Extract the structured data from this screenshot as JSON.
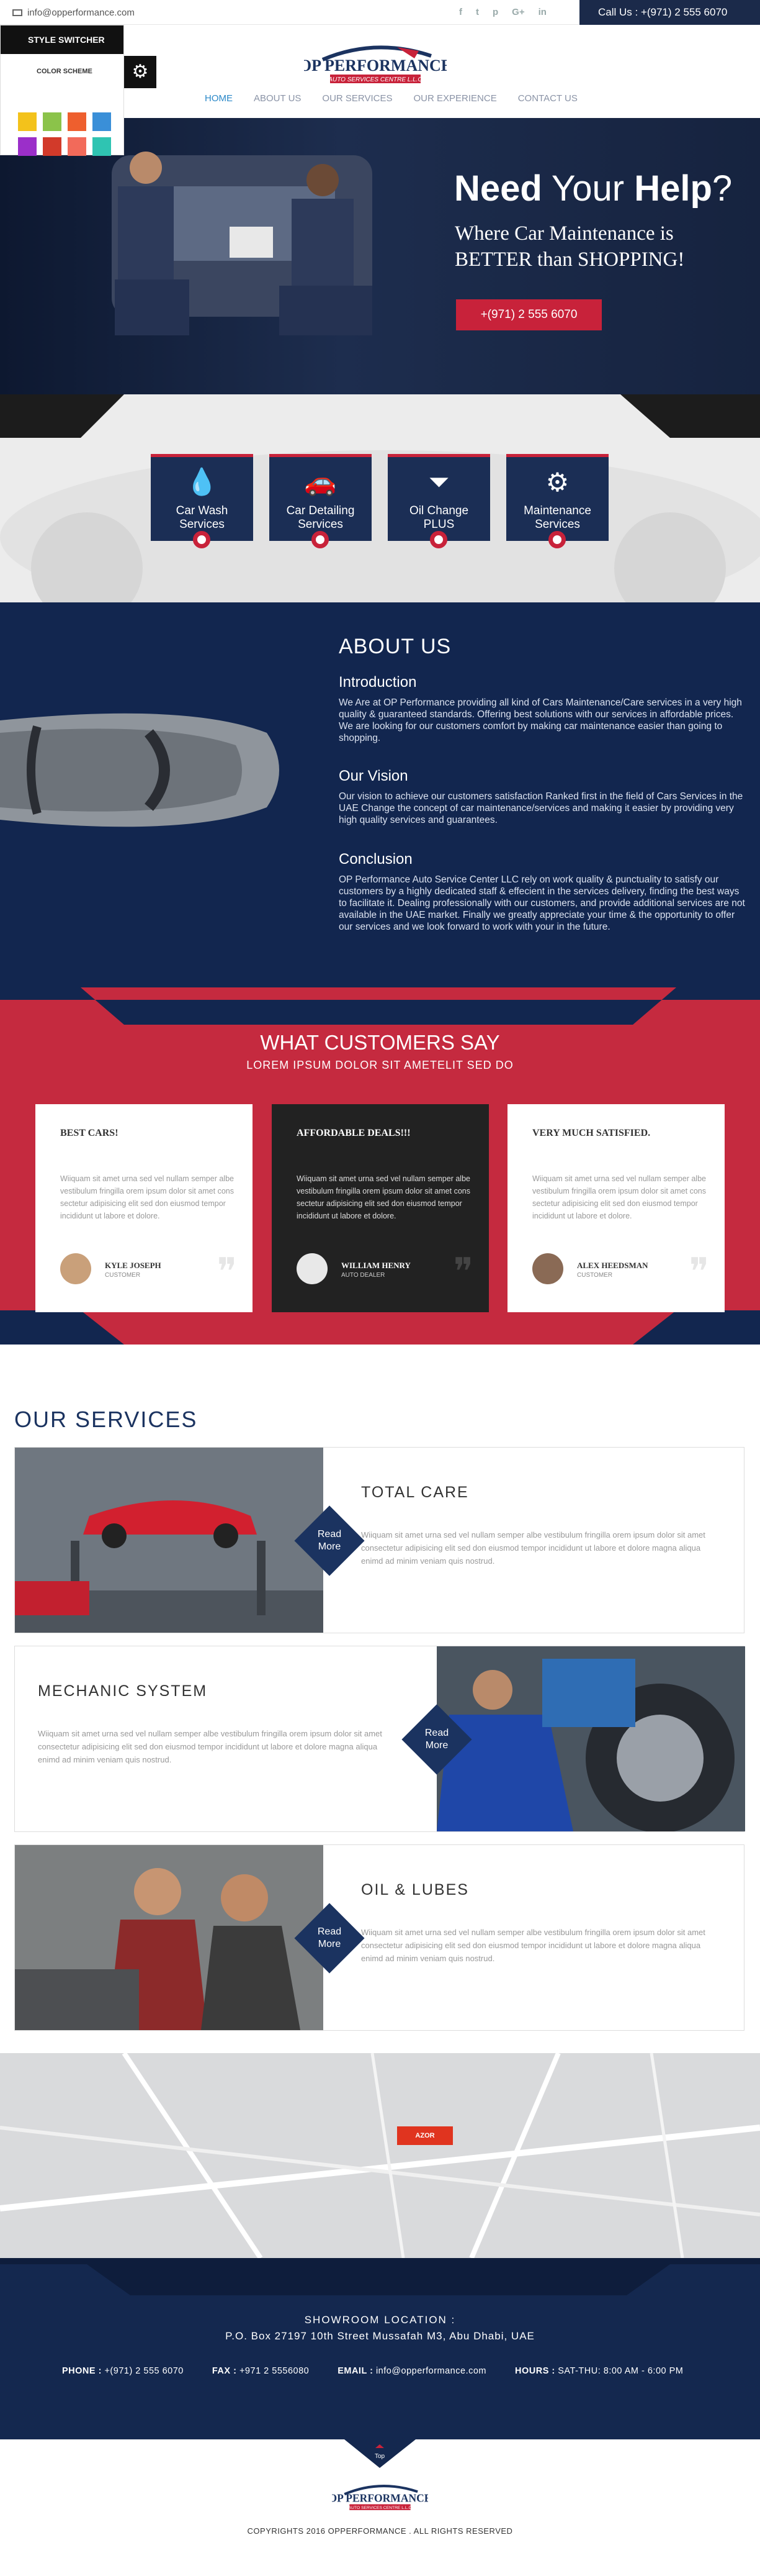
{
  "topbar": {
    "email": "info@opperformance.com",
    "social": [
      "f",
      "t",
      "p",
      "G+",
      "in"
    ],
    "call": "Call Us : +(971) 2 555 6070"
  },
  "logo": {
    "title": "OP PERFORMANCE",
    "subtitle": "AUTO SERVICES CENTRE L.L.C"
  },
  "nav": [
    "HOME",
    "ABOUT US",
    "OUR SERVICES",
    "OUR EXPERIENCE",
    "CONTACT US"
  ],
  "switcher": {
    "title": "STYLE SWITCHER",
    "subtitle": "COLOR SCHEME",
    "colors": [
      "#f3c21b",
      "#8bc34a",
      "#ee5f2e",
      "#3a8fd8",
      "#9b2fc9",
      "#d23a2a",
      "#f26a5a",
      "#2fc4b2"
    ]
  },
  "hero": {
    "title_bold1": "Need",
    "title_mid": " Your ",
    "title_bold2": "Help",
    "title_end": "?",
    "line1": "Where Car Maintenance is",
    "line2": "BETTER than SHOPPING!",
    "cta": "+(971) 2 555 6070"
  },
  "services_icons": [
    {
      "label1": "Car Wash",
      "label2": "Services",
      "icon": "water-drop-icon"
    },
    {
      "label1": "Car Detailing",
      "label2": "Services",
      "icon": "car-icon"
    },
    {
      "label1": "Oil Change",
      "label2": "PLUS",
      "icon": "funnel-icon"
    },
    {
      "label1": "Maintenance",
      "label2": "Services",
      "icon": "engine-icon"
    }
  ],
  "about": {
    "title": "ABOUT US",
    "intro_h": "Introduction",
    "intro": "We Are at OP Performance providing all kind of Cars Maintenance/Care services in a very high quality & guaranteed standards. Offering best solutions with our services in affordable prices. We are looking for our customers comfort by making car maintenance easier than going to shopping.",
    "vision_h": "Our Vision",
    "vision": "Our vision to achieve our customers satisfaction Ranked first in the field of Cars Services in the UAE Change the concept of car maintenance/services and making it easier by providing very high quality services and guarantees.",
    "conc_h": "Conclusion",
    "conc": "OP Performance Auto Service Center LLC rely on work quality & punctuality to satisfy our customers by a highly dedicated staff & effecient in the services delivery, finding the best ways to facilitate it. Dealing professionally with our customers, and provide additional services are not available in the UAE market. Finally we greatly appreciate your time & the opportunity to offer our services and we look forward to work with your in the future."
  },
  "testimonials": {
    "title": "WHAT CUSTOMERS SAY",
    "tagline": "LOREM IPSUM DOLOR SIT AMETELIT SED DO",
    "items": [
      {
        "title": "BEST CARS!",
        "body": "Wiiquam sit amet urna sed vel nullam semper albe vestibulum fringilla orem ipsum dolor sit amet cons sectetur adipisicing elit sed don eiusmod tempor incididunt ut labore et dolore.",
        "name": "KYLE JOSEPH",
        "role": "CUSTOMER"
      },
      {
        "title": "AFFORDABLE DEALS!!!",
        "body": "Wiiquam sit amet urna sed vel nullam semper albe vestibulum fringilla orem ipsum dolor sit amet cons sectetur adipisicing elit sed don eiusmod tempor incididunt ut labore et dolore.",
        "name": "WILLIAM HENRY",
        "role": "AUTO DEALER"
      },
      {
        "title": "VERY MUCH SATISFIED.",
        "body": "Wiiquam sit amet urna sed vel nullam semper albe vestibulum fringilla orem ipsum dolor sit amet cons sectetur adipisicing elit sed don eiusmod tempor incididunt ut labore et dolore.",
        "name": "ALEX HEEDSMAN",
        "role": "CUSTOMER"
      }
    ]
  },
  "our_services": {
    "title": "OUR SERVICES",
    "read_more1": "Read",
    "read_more2": "More",
    "items": [
      {
        "title": "TOTAL CARE",
        "body": "Wiiquam sit amet urna sed vel nullam semper albe vestibulum fringilla orem ipsum dolor sit amet consectetur adipisicing elit sed don eiusmod tempor incididunt ut labore et dolore magna aliqua enimd ad minim veniam quis nostrud."
      },
      {
        "title": "MECHANIC SYSTEM",
        "body": "Wiiquam sit amet urna sed vel nullam semper albe vestibulum fringilla orem ipsum dolor sit amet consectetur adipisicing elit sed don eiusmod tempor incididunt ut labore et dolore magna aliqua enimd ad minim veniam quis nostrud."
      },
      {
        "title": "OIL & LUBES",
        "body": "Wiiquam sit amet urna sed vel nullam semper albe vestibulum fringilla orem ipsum dolor sit amet consectetur adipisicing elit sed don eiusmod tempor incididunt ut labore et dolore magna aliqua enimd ad minim veniam quis nostrud."
      }
    ]
  },
  "map": {
    "marker": "AZOR"
  },
  "footer": {
    "showroom_h": "SHOWROOM LOCATION :",
    "address": "P.O. Box 27197 10th Street Mussafah M3, Abu Dhabi, UAE",
    "phone_l": "PHONE :",
    "phone": "+(971) 2 555 6070",
    "fax_l": "FAX :",
    "fax": "+971 2 5556080",
    "email_l": "EMAIL :",
    "email": "info@opperformance.com",
    "hours_l": "HOURS :",
    "hours": "SAT-THU: 8:00 AM - 6:00 PM",
    "top": "Top",
    "copyright": "COPYRIGHTS 2016 OPPERFORMANCE . ALL RIGHTS RESERVED"
  }
}
